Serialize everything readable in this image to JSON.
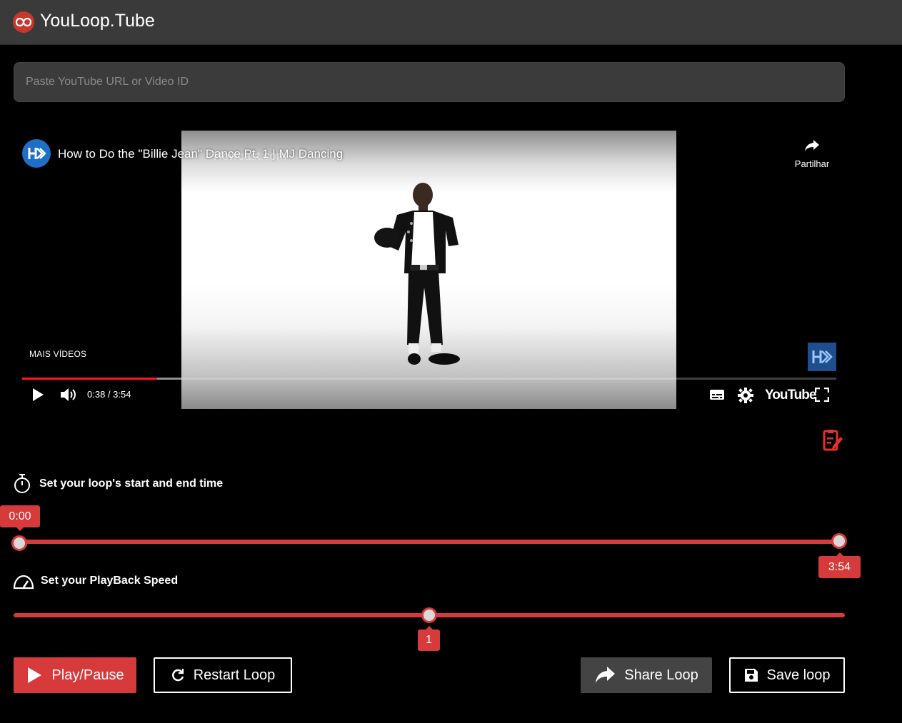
{
  "header": {
    "app_title": "YouLoop.Tube",
    "logo_icon": "infinity-logo-icon"
  },
  "search": {
    "placeholder": "Paste YouTube URL or Video ID",
    "value": ""
  },
  "player": {
    "video_title": "How to Do the \"Billie Jean\" Dance Pt. 1 | MJ Dancing",
    "watermark": "Howcast.com",
    "share_label": "Partilhar",
    "more_videos_label": "MAIS VÍDEOS",
    "time_display": "0:38 / 3:54",
    "played_fraction": 0.166,
    "buffered_fraction": 0.515,
    "youtube_label": "YouTube",
    "accent": "#ff1a1a"
  },
  "loop": {
    "label": "Set your loop's start and end time",
    "start_label": "0:00",
    "end_label": "3:54",
    "start_fraction": 0.0,
    "end_fraction": 1.0
  },
  "speed": {
    "label": "Set your PlayBack Speed",
    "value_label": "1",
    "fraction": 0.5
  },
  "buttons": {
    "play_pause": "Play/Pause",
    "restart_loop": "Restart Loop",
    "share_loop": "Share Loop",
    "save_loop": "Save loop"
  },
  "colors": {
    "accent_red": "#d63a3a",
    "header_bg": "#3a3a3a",
    "background": "#000000"
  }
}
